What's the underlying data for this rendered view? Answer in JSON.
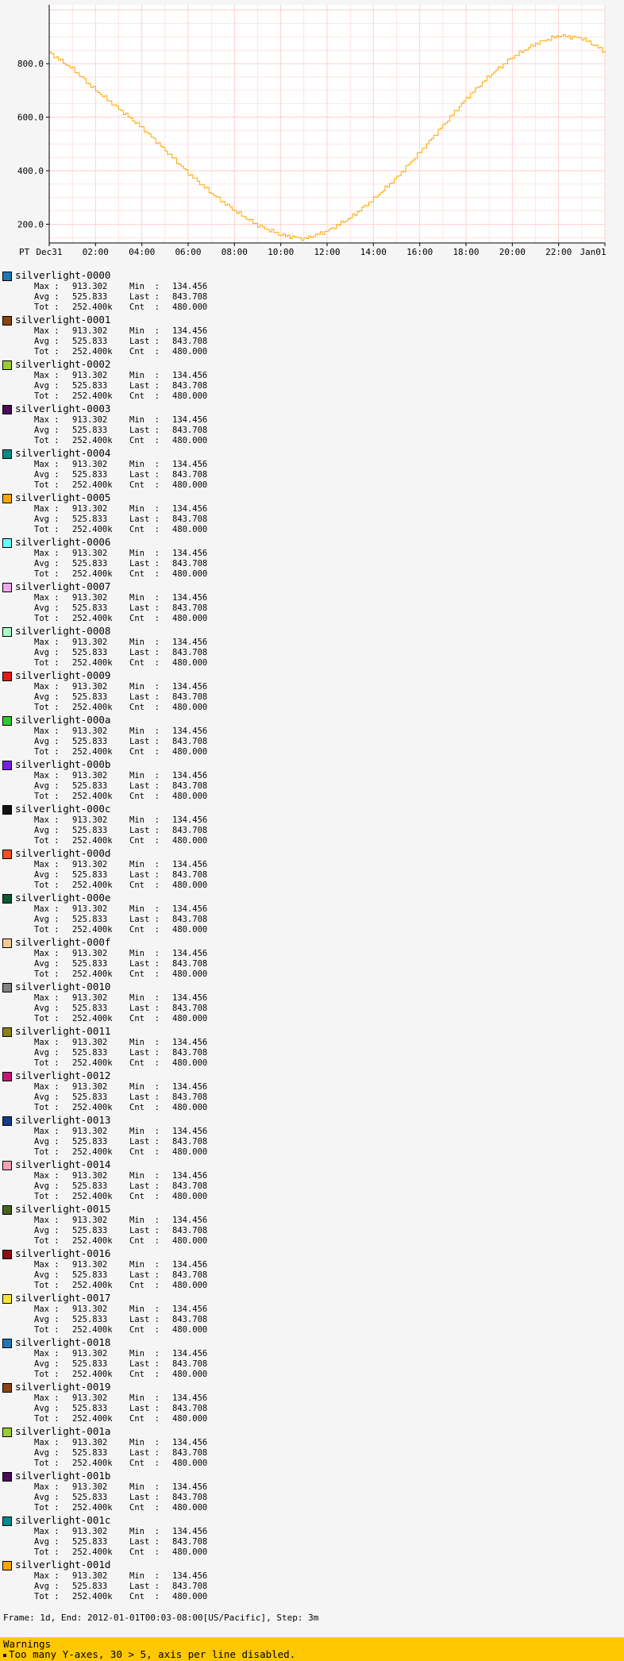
{
  "chart_data": {
    "type": "line",
    "timezone_label": "PT",
    "x_tick_labels": [
      "Dec31",
      "02:00",
      "04:00",
      "06:00",
      "08:00",
      "10:00",
      "12:00",
      "14:00",
      "16:00",
      "18:00",
      "20:00",
      "22:00",
      "Jan01"
    ],
    "y_tick_labels": [
      "200.0",
      "400.0",
      "600.0",
      "800.0"
    ],
    "y_ticks": [
      200,
      400,
      600,
      800
    ],
    "ylim": [
      130,
      1020
    ],
    "xlim_hours": [
      0,
      24
    ],
    "x_hours": [
      0,
      1,
      2,
      3,
      4,
      5,
      6,
      7,
      8,
      9,
      10,
      11,
      12,
      13,
      14,
      15,
      16,
      17,
      18,
      19,
      20,
      21,
      22,
      23,
      24
    ],
    "values": [
      840,
      780,
      700,
      630,
      560,
      475,
      390,
      315,
      250,
      195,
      160,
      145,
      175,
      225,
      295,
      375,
      470,
      570,
      670,
      755,
      825,
      875,
      905,
      895,
      845
    ],
    "line_color": "#ffa500",
    "grid": true,
    "grid_color": "#ffcccc"
  },
  "legend": {
    "entries": [
      {
        "name": "silverlight-0000",
        "color": "#1f77b4",
        "max": "913.302",
        "min": "134.456",
        "avg": "525.833",
        "last": "843.708",
        "tot": "252.400k",
        "cnt": "480.000"
      },
      {
        "name": "silverlight-0001",
        "color": "#8b4513",
        "max": "913.302",
        "min": "134.456",
        "avg": "525.833",
        "last": "843.708",
        "tot": "252.400k",
        "cnt": "480.000"
      },
      {
        "name": "silverlight-0002",
        "color": "#9acd32",
        "max": "913.302",
        "min": "134.456",
        "avg": "525.833",
        "last": "843.708",
        "tot": "252.400k",
        "cnt": "480.000"
      },
      {
        "name": "silverlight-0003",
        "color": "#4b0a5a",
        "max": "913.302",
        "min": "134.456",
        "avg": "525.833",
        "last": "843.708",
        "tot": "252.400k",
        "cnt": "480.000"
      },
      {
        "name": "silverlight-0004",
        "color": "#008b8b",
        "max": "913.302",
        "min": "134.456",
        "avg": "525.833",
        "last": "843.708",
        "tot": "252.400k",
        "cnt": "480.000"
      },
      {
        "name": "silverlight-0005",
        "color": "#ffa500",
        "max": "913.302",
        "min": "134.456",
        "avg": "525.833",
        "last": "843.708",
        "tot": "252.400k",
        "cnt": "480.000"
      },
      {
        "name": "silverlight-0006",
        "color": "#66ffff",
        "max": "913.302",
        "min": "134.456",
        "avg": "525.833",
        "last": "843.708",
        "tot": "252.400k",
        "cnt": "480.000"
      },
      {
        "name": "silverlight-0007",
        "color": "#f0a6f0",
        "max": "913.302",
        "min": "134.456",
        "avg": "525.833",
        "last": "843.708",
        "tot": "252.400k",
        "cnt": "480.000"
      },
      {
        "name": "silverlight-0008",
        "color": "#a8ffc8",
        "max": "913.302",
        "min": "134.456",
        "avg": "525.833",
        "last": "843.708",
        "tot": "252.400k",
        "cnt": "480.000"
      },
      {
        "name": "silverlight-0009",
        "color": "#e61919",
        "max": "913.302",
        "min": "134.456",
        "avg": "525.833",
        "last": "843.708",
        "tot": "252.400k",
        "cnt": "480.000"
      },
      {
        "name": "silverlight-000a",
        "color": "#32c832",
        "max": "913.302",
        "min": "134.456",
        "avg": "525.833",
        "last": "843.708",
        "tot": "252.400k",
        "cnt": "480.000"
      },
      {
        "name": "silverlight-000b",
        "color": "#7a1fe6",
        "max": "913.302",
        "min": "134.456",
        "avg": "525.833",
        "last": "843.708",
        "tot": "252.400k",
        "cnt": "480.000"
      },
      {
        "name": "silverlight-000c",
        "color": "#141414",
        "max": "913.302",
        "min": "134.456",
        "avg": "525.833",
        "last": "843.708",
        "tot": "252.400k",
        "cnt": "480.000"
      },
      {
        "name": "silverlight-000d",
        "color": "#f0501e",
        "max": "913.302",
        "min": "134.456",
        "avg": "525.833",
        "last": "843.708",
        "tot": "252.400k",
        "cnt": "480.000"
      },
      {
        "name": "silverlight-000e",
        "color": "#0f5a32",
        "max": "913.302",
        "min": "134.456",
        "avg": "525.833",
        "last": "843.708",
        "tot": "252.400k",
        "cnt": "480.000"
      },
      {
        "name": "silverlight-000f",
        "color": "#f5c896",
        "max": "913.302",
        "min": "134.456",
        "avg": "525.833",
        "last": "843.708",
        "tot": "252.400k",
        "cnt": "480.000"
      },
      {
        "name": "silverlight-0010",
        "color": "#828282",
        "max": "913.302",
        "min": "134.456",
        "avg": "525.833",
        "last": "843.708",
        "tot": "252.400k",
        "cnt": "480.000"
      },
      {
        "name": "silverlight-0011",
        "color": "#8c8214",
        "max": "913.302",
        "min": "134.456",
        "avg": "525.833",
        "last": "843.708",
        "tot": "252.400k",
        "cnt": "480.000"
      },
      {
        "name": "silverlight-0012",
        "color": "#c8147d",
        "max": "913.302",
        "min": "134.456",
        "avg": "525.833",
        "last": "843.708",
        "tot": "252.400k",
        "cnt": "480.000"
      },
      {
        "name": "silverlight-0013",
        "color": "#143c8c",
        "max": "913.302",
        "min": "134.456",
        "avg": "525.833",
        "last": "843.708",
        "tot": "252.400k",
        "cnt": "480.000"
      },
      {
        "name": "silverlight-0014",
        "color": "#f5a0b4",
        "max": "913.302",
        "min": "134.456",
        "avg": "525.833",
        "last": "843.708",
        "tot": "252.400k",
        "cnt": "480.000"
      },
      {
        "name": "silverlight-0015",
        "color": "#46641e",
        "max": "913.302",
        "min": "134.456",
        "avg": "525.833",
        "last": "843.708",
        "tot": "252.400k",
        "cnt": "480.000"
      },
      {
        "name": "silverlight-0016",
        "color": "#8c0f0f",
        "max": "913.302",
        "min": "134.456",
        "avg": "525.833",
        "last": "843.708",
        "tot": "252.400k",
        "cnt": "480.000"
      },
      {
        "name": "silverlight-0017",
        "color": "#f5e632",
        "max": "913.302",
        "min": "134.456",
        "avg": "525.833",
        "last": "843.708",
        "tot": "252.400k",
        "cnt": "480.000"
      },
      {
        "name": "silverlight-0018",
        "color": "#1f77b4",
        "max": "913.302",
        "min": "134.456",
        "avg": "525.833",
        "last": "843.708",
        "tot": "252.400k",
        "cnt": "480.000"
      },
      {
        "name": "silverlight-0019",
        "color": "#8b4513",
        "max": "913.302",
        "min": "134.456",
        "avg": "525.833",
        "last": "843.708",
        "tot": "252.400k",
        "cnt": "480.000"
      },
      {
        "name": "silverlight-001a",
        "color": "#9acd32",
        "max": "913.302",
        "min": "134.456",
        "avg": "525.833",
        "last": "843.708",
        "tot": "252.400k",
        "cnt": "480.000"
      },
      {
        "name": "silverlight-001b",
        "color": "#4b0a5a",
        "max": "913.302",
        "min": "134.456",
        "avg": "525.833",
        "last": "843.708",
        "tot": "252.400k",
        "cnt": "480.000"
      },
      {
        "name": "silverlight-001c",
        "color": "#008b8b",
        "max": "913.302",
        "min": "134.456",
        "avg": "525.833",
        "last": "843.708",
        "tot": "252.400k",
        "cnt": "480.000"
      },
      {
        "name": "silverlight-001d",
        "color": "#ffa500",
        "max": "913.302",
        "min": "134.456",
        "avg": "525.833",
        "last": "843.708",
        "tot": "252.400k",
        "cnt": "480.000"
      }
    ],
    "labels": {
      "max": "Max :",
      "min": "Min  :",
      "avg": "Avg :",
      "last": "Last :",
      "tot": "Tot :",
      "cnt": "Cnt  :"
    }
  },
  "footer": {
    "text": "Frame: 1d, End: 2012-01-01T00:03-08:00[US/Pacific], Step: 3m"
  },
  "warnings": {
    "title": "Warnings",
    "items": [
      "Too many Y-axes, 30 > 5, axis per line disabled."
    ]
  }
}
